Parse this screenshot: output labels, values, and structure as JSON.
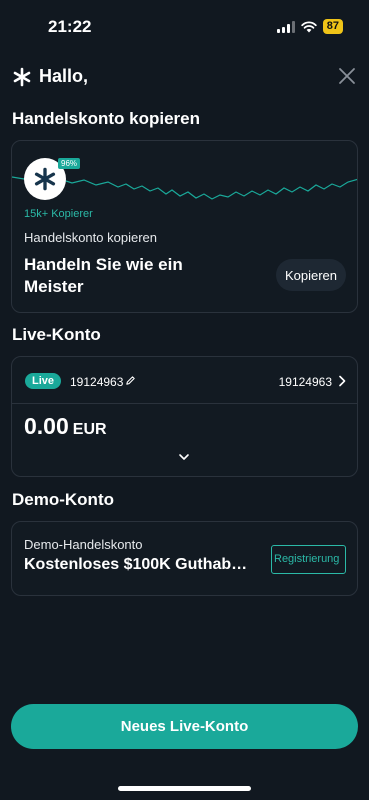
{
  "status": {
    "time": "21:22",
    "battery": "87"
  },
  "header": {
    "greeting": "Hallo,"
  },
  "copy_section": {
    "title": "Handelskonto kopieren",
    "badge_pct": "96%",
    "copiers": "15k+ Kopierer",
    "subtitle": "Handelskonto kopieren",
    "headline": "Handeln Sie wie ein Meister",
    "button": "Kopieren"
  },
  "live_section": {
    "title": "Live-Konto",
    "badge": "Live",
    "account_number": "19124963",
    "account_number_right": "19124963",
    "balance": "0.00",
    "currency": "EUR"
  },
  "demo_section": {
    "title": "Demo-Konto",
    "subtitle": "Demo-Handelskonto",
    "headline": "Kostenloses $100K Guthab…",
    "button": "Registrierung"
  },
  "footer": {
    "new_account_button": "Neues Live-Konto"
  },
  "colors": {
    "accent": "#1aa99a",
    "background": "#111820",
    "card_border": "#2a323c"
  }
}
